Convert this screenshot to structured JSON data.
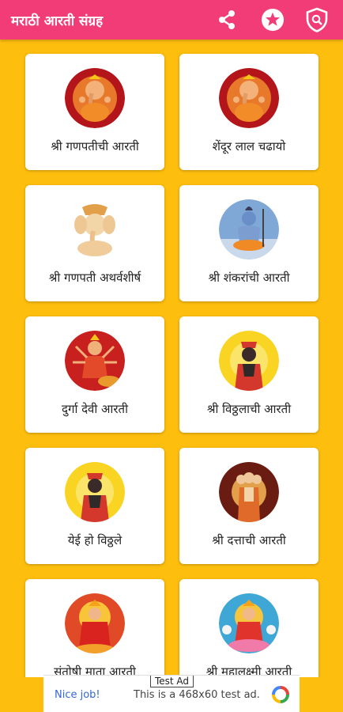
{
  "app": {
    "title": "मराठी आरती संग्रह",
    "accent_color": "#F23C78",
    "background_color": "#FDBE0E",
    "actions": [
      {
        "icon": "share-icon"
      },
      {
        "icon": "star-icon"
      },
      {
        "icon": "privacy-shield-icon"
      }
    ]
  },
  "cards": [
    {
      "label": "श्री गणपतीची आरती",
      "image": "ganesh-image"
    },
    {
      "label": "शेंदूर लाल चढायो",
      "image": "ganesh-image"
    },
    {
      "label": "श्री गणपती अथर्वशीर्ष",
      "image": "ganesh-idol-image"
    },
    {
      "label": "श्री शंकरांची आरती",
      "image": "shiva-image"
    },
    {
      "label": "दुर्गा देवी आरती",
      "image": "durga-image"
    },
    {
      "label": "श्री विठ्ठलाची आरती",
      "image": "vitthal-image"
    },
    {
      "label": "येई हो विठ्ठले",
      "image": "vitthal-image"
    },
    {
      "label": "श्री दत्ताची आरती",
      "image": "datta-image"
    },
    {
      "label": "संतोषी माता आरती",
      "image": "santoshi-mata-image"
    },
    {
      "label": "श्री महालक्ष्मी आरती",
      "image": "mahalakshmi-image"
    }
  ],
  "ad": {
    "badge": "Test Ad",
    "headline": "Nice job!",
    "message": "This is a 468x60 test ad."
  }
}
